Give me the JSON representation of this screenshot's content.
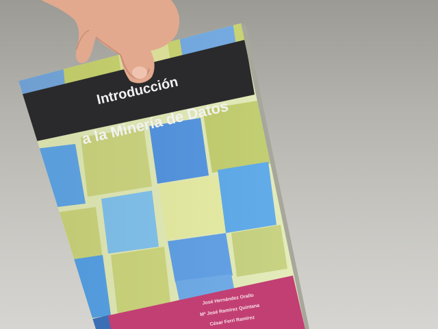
{
  "photo": {
    "subject": "book-held-by-hand",
    "book": {
      "title_line_1": "Introducción",
      "title_line_2": "a la Minería de Datos",
      "authors": [
        "José Hernández Orallo",
        "Mª José Ramírez Quintana",
        "César Ferri Ramírez"
      ]
    },
    "colors": {
      "background": "#c4c3bf",
      "title_band": "#2a2a2c",
      "author_band": "#c23f73",
      "tile_blue": "#5aa3e6",
      "tile_green": "#c8d27a",
      "cover_base": "#e4ecb8"
    }
  }
}
